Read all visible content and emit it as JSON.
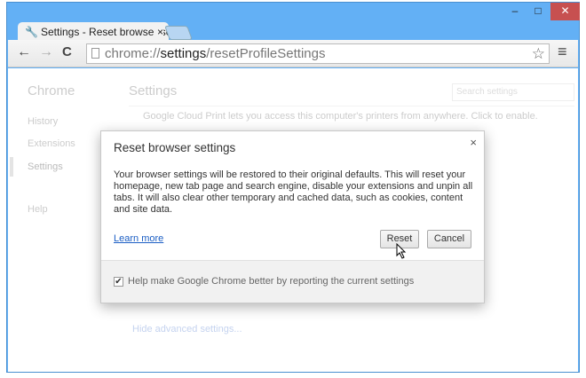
{
  "window": {
    "minimize": "–",
    "maximize": "□",
    "close": "✕",
    "close_color": "#c75050"
  },
  "tab": {
    "title": "Settings - Reset browser se",
    "close": "×"
  },
  "toolbar": {
    "back": "←",
    "forward": "→",
    "reload": "C",
    "url_scheme": "chrome://",
    "url_host": "settings",
    "url_path": "/resetProfileSettings",
    "star": "☆",
    "menu": "≡"
  },
  "sidebar": {
    "title": "Chrome",
    "items": [
      "History",
      "Extensions",
      "Settings",
      "Help"
    ]
  },
  "main": {
    "title": "Settings",
    "search_placeholder": "Search settings",
    "cloud_print": "Google Cloud Print lets you access this computer's printers from anywhere. Click to enable.",
    "hide_advanced": "Hide advanced settings..."
  },
  "dialog": {
    "title": "Reset browser settings",
    "close": "×",
    "body": "Your browser settings will be restored to their original defaults. This will reset your homepage, new tab page and search engine, disable your extensions and unpin all tabs. It will also clear other temporary and cached data, such as cookies, content and site data.",
    "learn_more": "Learn more",
    "reset": "Reset",
    "cancel": "Cancel",
    "checkbox_label": "Help make Google Chrome better by reporting the current settings",
    "checkbox_checked": true,
    "check_mark": "✔"
  }
}
